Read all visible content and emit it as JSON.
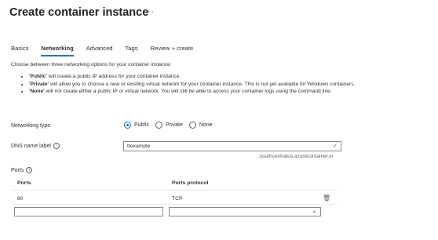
{
  "page": {
    "title": "Create container instance",
    "more_icon": "more-icon"
  },
  "tabs": [
    {
      "label": "Basics",
      "active": false
    },
    {
      "label": "Networking",
      "active": true
    },
    {
      "label": "Advanced",
      "active": false
    },
    {
      "label": "Tags",
      "active": false
    },
    {
      "label": "Review + create",
      "active": false
    }
  ],
  "intro": "Choose between three networking options for your container instance:",
  "options": [
    {
      "name": "'Public'",
      "desc": " will create a public IP address for your container instance."
    },
    {
      "name": "'Private'",
      "desc": " will allow you to choose a new or existing virtual network for your container instance. This is not yet available for Windows containers."
    },
    {
      "name": "'None'",
      "desc": " will not create either a public IP or virtual network. You will still be able to access your container logs using the command line."
    }
  ],
  "networking_type": {
    "label": "Networking type",
    "options": [
      "Public",
      "Private",
      "None"
    ],
    "selected": "Public"
  },
  "dns": {
    "label": "DNS name label",
    "value": "ttexample",
    "suffix": ".southcentralus.azurecontainer.io",
    "valid": true
  },
  "ports": {
    "label": "Ports",
    "columns": [
      "Ports",
      "Ports protocol"
    ],
    "rows": [
      {
        "port": "80",
        "protocol": "TCP"
      }
    ],
    "new_row": {
      "port": "",
      "protocol": ""
    }
  },
  "icons": {
    "info": "info-icon",
    "check": "checkmark-icon",
    "trash": "trash-icon",
    "chevron": "chevron-down-icon"
  }
}
